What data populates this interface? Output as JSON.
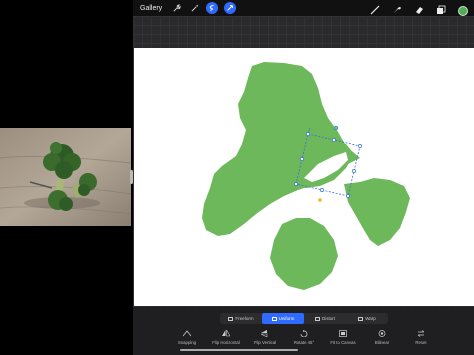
{
  "topbar": {
    "gallery_label": "Gallery",
    "left_icons": [
      "wrench-icon",
      "magic-wand-icon",
      "selection-icon",
      "transform-arrow-icon"
    ],
    "right_icons": [
      "brush-icon",
      "smudge-icon",
      "eraser-icon",
      "layers-icon"
    ],
    "active_color": "#4caf50",
    "accent": "#2f6bff"
  },
  "transform": {
    "modes": [
      {
        "label": "Freeform",
        "selected": false
      },
      {
        "label": "Uniform",
        "selected": true
      },
      {
        "label": "Distort",
        "selected": false
      },
      {
        "label": "Warp",
        "selected": false
      }
    ],
    "actions": [
      {
        "label": "Snapping",
        "icon": "snapping-icon"
      },
      {
        "label": "Flip Horizontal",
        "icon": "flip-horizontal-icon"
      },
      {
        "label": "Flip Vertical",
        "icon": "flip-vertical-icon"
      },
      {
        "label": "Rotate 45°",
        "icon": "rotate-icon"
      },
      {
        "label": "Fit to Canvas",
        "icon": "fit-to-canvas-icon"
      },
      {
        "label": "Bilinear",
        "icon": "bilinear-icon"
      },
      {
        "label": "Reset",
        "icon": "reset-icon"
      }
    ]
  },
  "artwork": {
    "fill_color": "#6cb85b",
    "selection_color": "#3a6fd8"
  }
}
